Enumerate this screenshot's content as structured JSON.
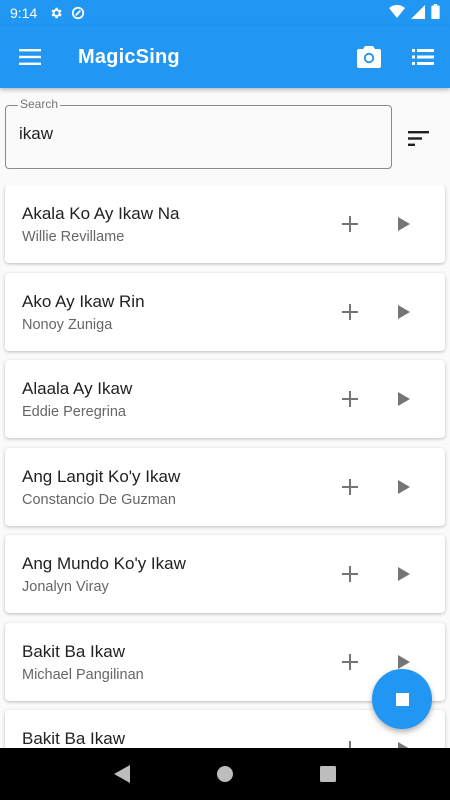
{
  "status_bar": {
    "time": "9:14",
    "left_icons": [
      "settings-icon",
      "circle-notification-icon"
    ],
    "right_icons": [
      "wifi-icon",
      "signal-icon",
      "battery-icon"
    ]
  },
  "app_bar": {
    "title": "MagicSing",
    "color": "#2196f3",
    "icons": [
      "menu-icon",
      "camera-icon",
      "queue-list-icon"
    ]
  },
  "search": {
    "label": "Search",
    "value": "ikaw"
  },
  "songs": [
    {
      "title": "Akala Ko Ay Ikaw Na",
      "artist": "Willie Revillame"
    },
    {
      "title": "Ako Ay Ikaw Rin",
      "artist": "Nonoy Zuniga"
    },
    {
      "title": "Alaala Ay Ikaw",
      "artist": "Eddie Peregrina"
    },
    {
      "title": "Ang Langit Ko'y Ikaw",
      "artist": "Constancio De Guzman"
    },
    {
      "title": "Ang Mundo Ko'y Ikaw",
      "artist": "Jonalyn Viray"
    },
    {
      "title": "Bakit Ba Ikaw",
      "artist": "Michael Pangilinan"
    },
    {
      "title": "Bakit Ba Ikaw",
      "artist": ""
    }
  ],
  "fab": {
    "icon": "stop-icon"
  },
  "nav_bar": {
    "icons": [
      "back-icon",
      "home-icon",
      "recents-icon"
    ]
  }
}
